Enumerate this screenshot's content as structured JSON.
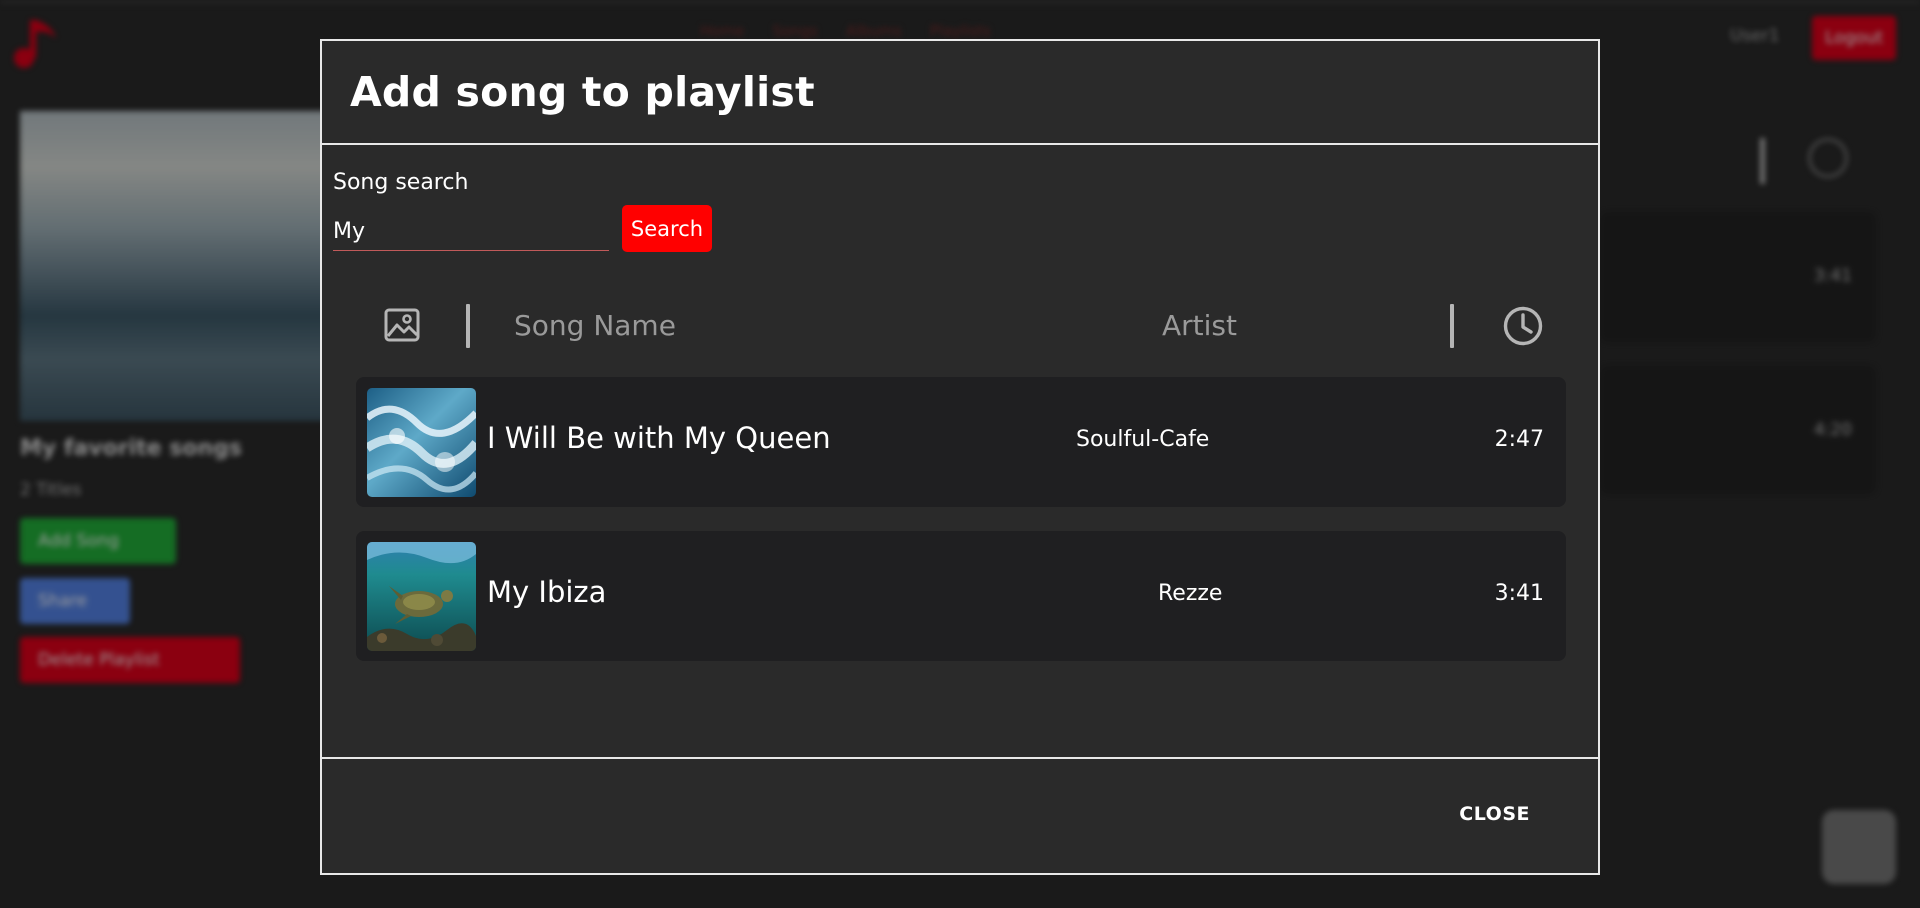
{
  "background": {
    "nav": [
      "Home",
      "Songs",
      "Albums",
      "Playlists"
    ],
    "user_label": "User1",
    "logout_label": "Logout",
    "playlist_title": "My favorite songs",
    "playlist_count": "2 Titles",
    "add_song_label": "Add Song",
    "share_label": "Share",
    "delete_label": "Delete Playlist",
    "durations": [
      "3:41",
      "4:20"
    ]
  },
  "modal": {
    "title": "Add song to playlist",
    "search_label": "Song search",
    "search_value": "My",
    "search_button": "Search",
    "columns": {
      "image_icon": "image-icon",
      "song_name": "Song Name",
      "artist": "Artist",
      "duration_icon": "clock-icon"
    },
    "songs": [
      {
        "name": "I Will Be with My Queen",
        "artist": "Soulful-Cafe",
        "duration": "2:47",
        "thumb": "ocean-wave"
      },
      {
        "name": "My Ibiza",
        "artist": "Rezze",
        "duration": "3:41",
        "thumb": "sea-turtle"
      }
    ],
    "close_label": "CLOSE"
  },
  "colors": {
    "accent": "#ff0000",
    "background": "#2a2a2a",
    "row": "#1f1f21",
    "muted_text": "#9a9a9a"
  }
}
